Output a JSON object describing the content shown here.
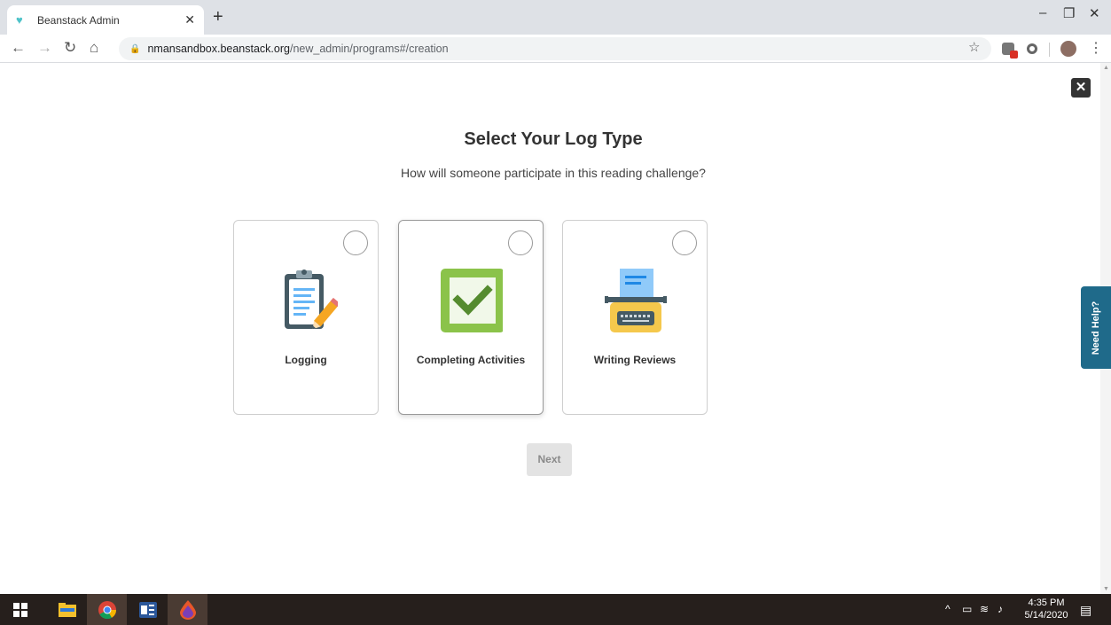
{
  "browser": {
    "tab_title": "Beanstack Admin",
    "url_domain": "nmansandbox.beanstack.org",
    "url_path": "/new_admin/programs#/creation"
  },
  "page": {
    "title": "Select Your Log Type",
    "subtitle": "How will someone participate in this reading challenge?",
    "options": [
      {
        "label": "Logging",
        "icon": "clipboard-pencil-icon",
        "selected": false
      },
      {
        "label": "Completing Activities",
        "icon": "checkbox-icon",
        "selected": false
      },
      {
        "label": "Writing Reviews",
        "icon": "typewriter-icon",
        "selected": false
      }
    ],
    "next_label": "Next",
    "help_label": "Need Help?"
  },
  "taskbar": {
    "time": "4:35 PM",
    "date": "5/14/2020"
  },
  "colors": {
    "accent_help": "#1f6a8a",
    "check_green": "#8bc34a",
    "typewriter_yellow": "#f5c84c",
    "clipboard_blue": "#64b5f6"
  }
}
